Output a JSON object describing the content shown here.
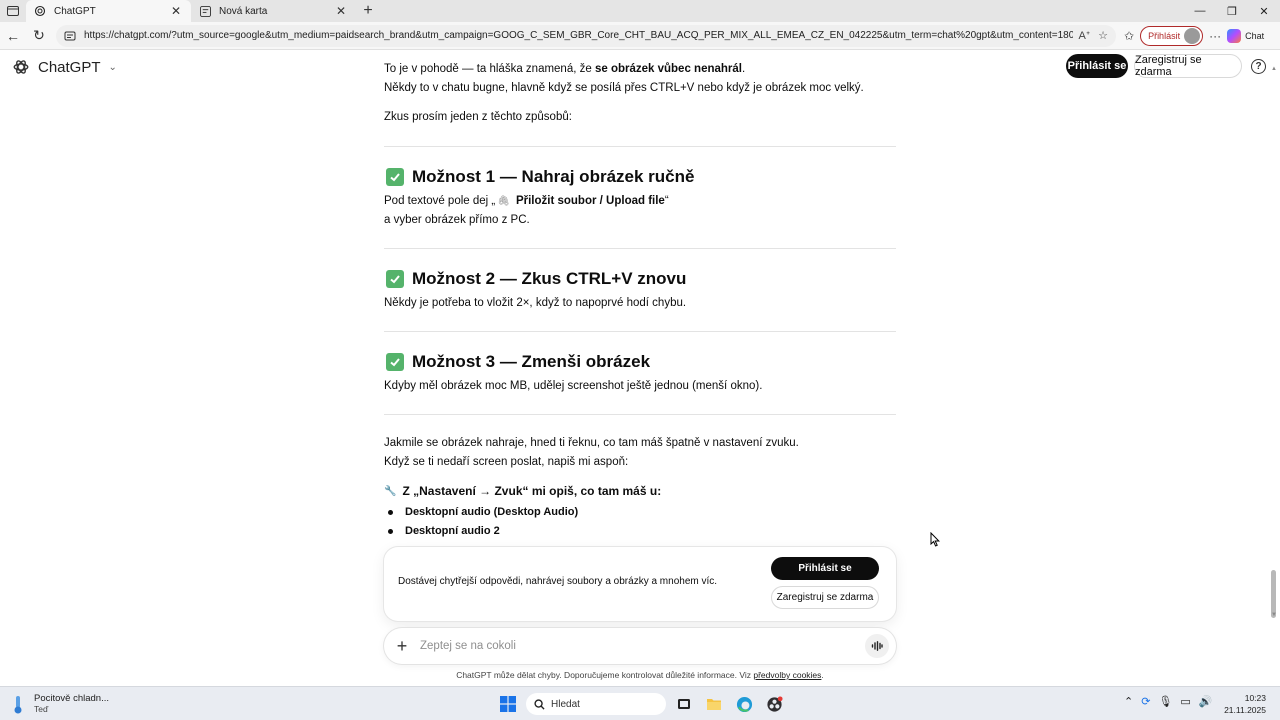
{
  "browser": {
    "tabs": [
      {
        "title": "ChatGPT",
        "active": true
      },
      {
        "title": "Nová karta",
        "active": false
      }
    ],
    "url": "https://chatgpt.com/?utm_source=google&utm_medium=paidsearch_brand&utm_campaign=GOOG_C_SEM_GBR_Core_CHT_BAU_ACQ_PER_MIX_ALL_EMEA_CZ_EN_042225&utm_term=chat%20gpt&utm_content=180892844600&utm_ad=7...",
    "profile_label": "Přihlásit",
    "chat_label": "Chat"
  },
  "header": {
    "brand": "ChatGPT",
    "login_label": "Přihlásit se",
    "register_label": "Zaregistruj se zdarma",
    "help_label": "?"
  },
  "message": {
    "intro_line1_pre": "To je v pohodě — ta hláška znamená, že ",
    "intro_line1_bold": "se obrázek vůbec nenahrál",
    "intro_line1_post": ".",
    "intro_line2": "Někdy to v chatu bugne, hlavně když se posílá přes CTRL+V nebo když je obrázek moc velký.",
    "intro_line3": "Zkus prosím jeden z těchto způsobů:",
    "option1_title": "Možnost 1 — Nahraj obrázek ručně",
    "option1_line1_pre": "Pod textové pole dej „",
    "option1_line1_bold": "Přiložit soubor / Upload file",
    "option1_line1_post": "“",
    "option1_line2": "a vyber obrázek přímo z PC.",
    "option2_title": "Možnost 2 — Zkus CTRL+V znovu",
    "option2_line1": "Někdy je potřeba to vložit 2×, když to napoprvé hodí chybu.",
    "option3_title": "Možnost 3 — Zmenši obrázek",
    "option3_line1": "Kdyby měl obrázek moc MB, udělej screenshot ještě jednou (menší okno).",
    "outro_line1": "Jakmile se obrázek nahraje, hned ti řeknu, co tam máš špatně v nastavení zvuku.",
    "outro_line2": "Když se ti nedaří screen poslat, napiš mi aspoň:",
    "settings_heading": "Z „Nastavení → Zvuk“ mi opiš, co tam máš u:",
    "bullets": [
      "Desktopní audio (Desktop Audio)",
      "Desktopní audio 2"
    ]
  },
  "promo": {
    "text": "Dostávej chytřejší odpovědi, nahrávej soubory a obrázky a mnohem víc.",
    "login_label": "Přihlásit se",
    "register_label": "Zaregistruj se zdarma"
  },
  "composer": {
    "placeholder": "Zeptej se na cokoli"
  },
  "footer": {
    "disclaimer": "ChatGPT může dělat chyby. Doporučujeme kontrolovat důležité informace. Viz ",
    "link": "předvolby cookies",
    "tail": "."
  },
  "taskbar": {
    "weather_title": "Pocitově chladn...",
    "weather_sub": "Teď",
    "search_label": "Hledat",
    "time": "10:23",
    "date": "21.11.2025"
  },
  "colors": {
    "check_green": "#55b36b",
    "button_dark": "#0d0d0d",
    "profile_red": "#b02a2a"
  }
}
